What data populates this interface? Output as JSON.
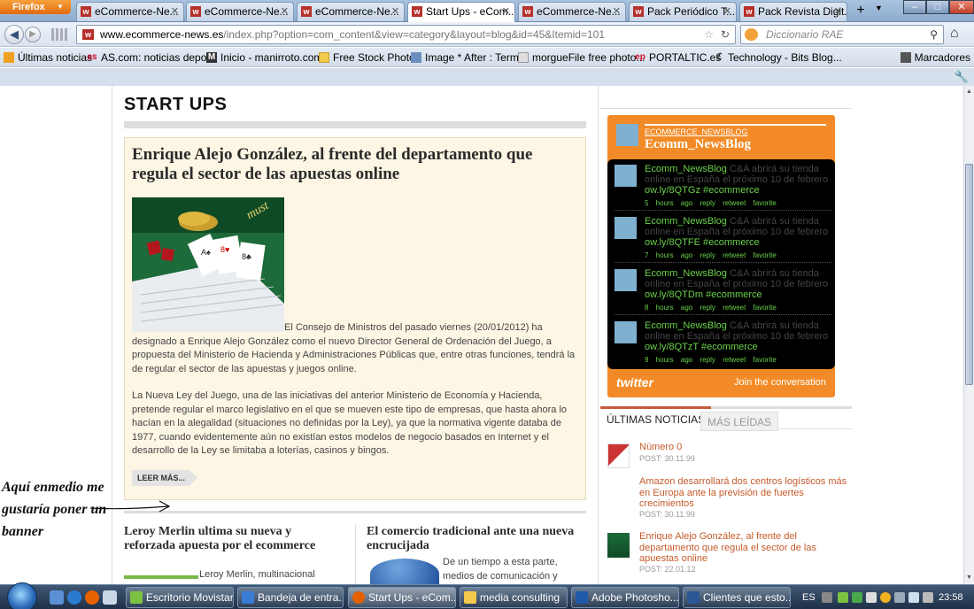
{
  "browser": {
    "app_button": "Firefox",
    "tabs": [
      {
        "label": "eCommerce-Ne...",
        "active": false
      },
      {
        "label": "eCommerce-Ne...",
        "active": false
      },
      {
        "label": "eCommerce-Ne...",
        "active": false
      },
      {
        "label": "Start Ups - eCom...",
        "active": true
      },
      {
        "label": "eCommerce-Ne...",
        "active": false
      },
      {
        "label": "Pack Periódico T...",
        "active": false
      },
      {
        "label": "Pack Revista Digit...",
        "active": false
      }
    ],
    "new_tab": "+",
    "url_domain": "www.ecommerce-news.es",
    "url_path": "/index.php?option=com_content&view=category&layout=blog&id=45&Itemid=101",
    "search_placeholder": "Diccionario RAE",
    "bookmarks": [
      {
        "label": "Últimas noticias",
        "icon": "rss-icon",
        "color": "#f0a020"
      },
      {
        "label": "AS.com: noticias depo...",
        "icon": "as-icon",
        "color": "#c8102e"
      },
      {
        "label": "Inicio - manirroto.com",
        "icon": "m-icon",
        "color": "#333333"
      },
      {
        "label": "Free Stock Photos",
        "icon": "folder-icon",
        "color": "#f2c94c"
      },
      {
        "label": "Image * After : Terms",
        "icon": "image-icon",
        "color": "#6a8fbf"
      },
      {
        "label": "morgueFile free photo...",
        "icon": "file-icon",
        "color": "#999999"
      },
      {
        "label": "PORTALTIC.es",
        "icon": "ep-icon",
        "color": "#c8102e"
      },
      {
        "label": "Technology - Bits Blog...",
        "icon": "t-icon",
        "color": "#222222"
      }
    ],
    "bookmarks_menu": "Marcadores"
  },
  "page": {
    "section_title": "START UPS",
    "article": {
      "title": "Enrique Alejo González, al frente del departamento que regula el sector de las apuestas online",
      "paragraph1": "El Consejo de Ministros del pasado viernes (20/01/2012) ha designado a Enrique Alejo González como el nuevo Director General de Ordenación del Juego, a propuesta del Ministerio de Hacienda y Administraciones Públicas que, entre otras funciones, tendrá la de regular el sector de las apuestas y juegos online.",
      "paragraph2": "La Nueva Ley del Juego, una de las iniciativas del anterior Ministerio de Economía y Hacienda, pretende regular el marco legislativo en el que se mueven este tipo de empresas, que hasta ahora lo hacían en la alegalidad (situaciones no definidas por la Ley), ya que la normativa vigente databa de 1977, cuando evidentemente aún no existían estos modelos de negocio basados en Internet y el desarrollo de la Ley se limitaba a loterías, casinos y bingos.",
      "read_more": "LEER MÁS..."
    },
    "sub_articles": [
      {
        "title": "Leroy Merlin ultima su nueva y reforzada apuesta por el ecommerce",
        "excerpt": "Leroy Merlin, multinacional"
      },
      {
        "title": "El comercio tradicional ante una nueva encrucijada",
        "excerpt": "De un tiempo a esta parte, medios de comunicación y"
      }
    ],
    "annotation": "Aquí enmedio me gustaría poner un banner"
  },
  "sidebar": {
    "twitter": {
      "screen_name_caps": "ECOMMERCE_NEWSBLOG",
      "screen_name": "Ecomm_NewsBlog",
      "tweets": [
        {
          "user": "Ecomm_NewsBlog",
          "text": "C&A abrirá su tienda online en España el próximo 10 de febrero",
          "link": "ow.ly/8QTGz #ecommerce",
          "time": "5 hours ago",
          "reply": "reply",
          "retweet": "retweet",
          "favorite": "favorite"
        },
        {
          "user": "Ecomm_NewsBlog",
          "text": "C&A abrirá su tienda online en España el próximo 10 de febrero",
          "link": "ow.ly/8QTFE #ecommerce",
          "time": "7 hours ago",
          "reply": "reply",
          "retweet": "retweet",
          "favorite": "favorite"
        },
        {
          "user": "Ecomm_NewsBlog",
          "text": "C&A abrirá su tienda online en España el próximo 10 de febrero",
          "link": "ow.ly/8QTDm #ecommerce",
          "time": "8 hours ago",
          "reply": "reply",
          "retweet": "retweet",
          "favorite": "favorite"
        },
        {
          "user": "Ecomm_NewsBlog",
          "text": "C&A abrirá su tienda online en España el próximo 10 de febrero",
          "link": "ow.ly/8QTzT #ecommerce",
          "time": "9 hours ago",
          "reply": "reply",
          "retweet": "retweet",
          "favorite": "favorite"
        }
      ],
      "logo": "twitter",
      "join": "Join the conversation"
    },
    "news_tabs": {
      "active": "ÚLTIMAS NOTICIAS",
      "other": "MÁS LEÍDAS"
    },
    "news": [
      {
        "title": "Número 0",
        "date": "POST: 30.11.99"
      },
      {
        "title": "Amazon desarrollará dos centros logísticos más en Europa ante la previsión de fuertes crecimientos",
        "date": "POST: 30.11.99"
      },
      {
        "title": "Enrique Alejo González, al frente del departamento que regula el sector de las apuestas online",
        "date": "POST: 22.01.12"
      }
    ]
  },
  "taskbar": {
    "items": [
      {
        "label": "Escritorio Movistar",
        "icon": "movistar-icon",
        "color": "#7cc242"
      },
      {
        "label": "Bandeja de entra...",
        "icon": "mail-icon",
        "color": "#3a7bd5"
      },
      {
        "label": "Start Ups - eCom...",
        "icon": "firefox-icon",
        "color": "#e66000"
      },
      {
        "label": "media consulting",
        "icon": "folder-icon",
        "color": "#f2c94c"
      },
      {
        "label": "Adobe Photosho...",
        "icon": "photoshop-icon",
        "color": "#1e5aa8"
      },
      {
        "label": "Clientes que esto...",
        "icon": "word-icon",
        "color": "#2b5797"
      }
    ],
    "language": "ES",
    "clock": "23:58"
  },
  "colors": {
    "accent": "#f28b27",
    "link": "#c55a2a",
    "tweet_green": "#6ad14a",
    "article_bg": "#fdf6e4"
  }
}
